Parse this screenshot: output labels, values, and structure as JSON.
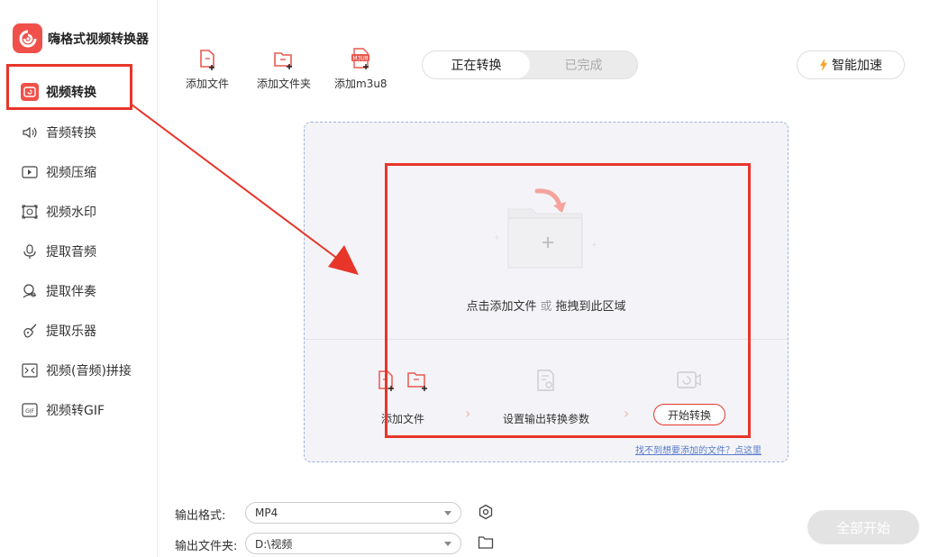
{
  "app": {
    "title": "嗨格式视频转换器"
  },
  "sidebar": {
    "items": [
      {
        "label": "视频转换",
        "icon": "video-convert-icon",
        "active": true
      },
      {
        "label": "音频转换",
        "icon": "speaker-icon"
      },
      {
        "label": "视频压缩",
        "icon": "video-compress-icon"
      },
      {
        "label": "视频水印",
        "icon": "watermark-icon"
      },
      {
        "label": "提取音频",
        "icon": "extract-audio-icon"
      },
      {
        "label": "提取伴奏",
        "icon": "accompaniment-icon"
      },
      {
        "label": "提取乐器",
        "icon": "guitar-icon"
      },
      {
        "label": "视频(音频)拼接",
        "icon": "merge-icon"
      },
      {
        "label": "视频转GIF",
        "icon": "gif-icon"
      }
    ]
  },
  "toolbar": {
    "add_file": "添加文件",
    "add_folder": "添加文件夹",
    "add_m3u8": "添加m3u8",
    "m3u8_badge": "M3U8"
  },
  "tabs": {
    "converting": "正在转换",
    "done": "已完成"
  },
  "accel": {
    "label": "智能加速"
  },
  "dropzone": {
    "prompt_click": "点击添加文件",
    "prompt_or": "或",
    "prompt_drag": "拖拽到此区域",
    "step1": "添加文件",
    "step2": "设置输出转换参数",
    "step3": "开始转换",
    "help_link": "找不到想要添加的文件？点这里"
  },
  "output": {
    "format_label": "输出格式:",
    "format_value": "MP4",
    "folder_label": "输出文件夹:",
    "folder_value": "D:\\视频"
  },
  "start_all": {
    "label": "全部开始"
  },
  "colors": {
    "accent": "#f0504a",
    "annotation": "#e8352a"
  }
}
